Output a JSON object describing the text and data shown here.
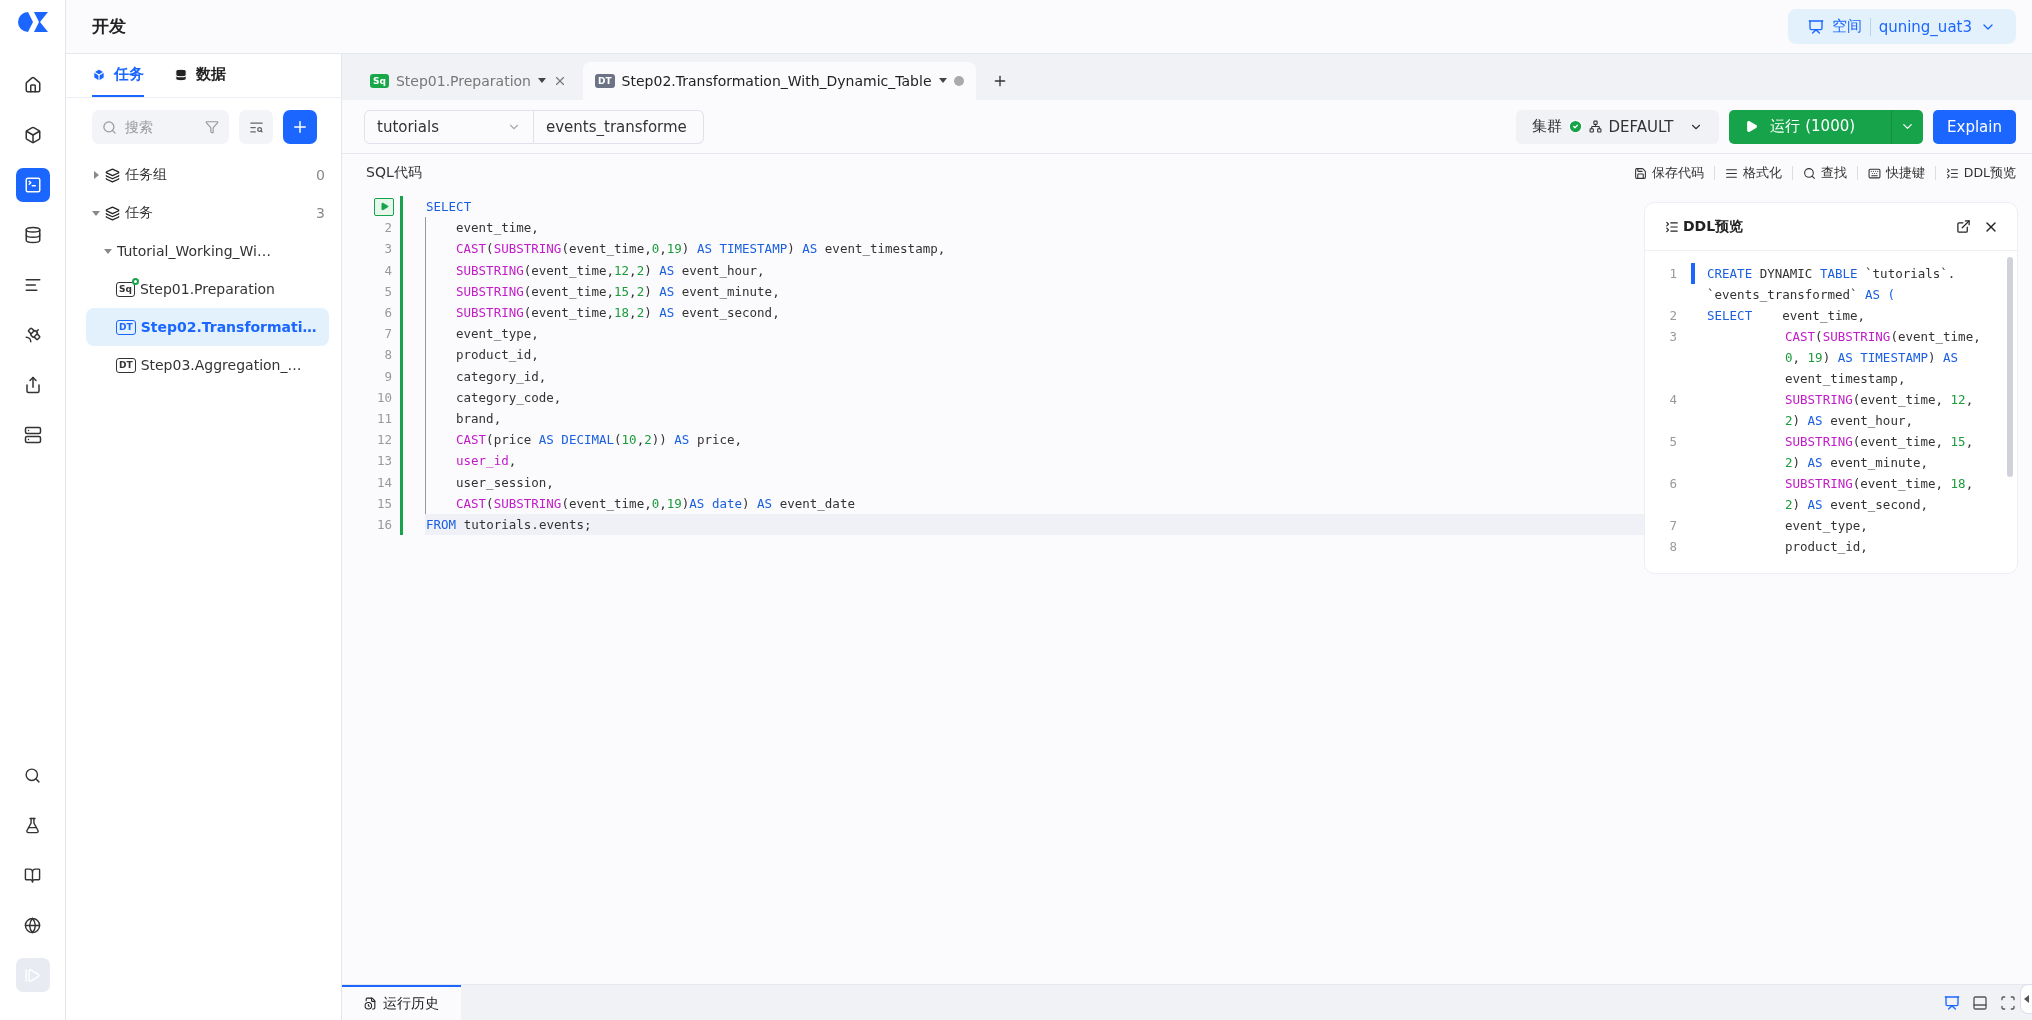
{
  "header": {
    "title": "开发",
    "space": {
      "label": "空间",
      "value": "quning_uat3"
    }
  },
  "rail": {
    "top": [
      {
        "kind": "home",
        "selected": false
      },
      {
        "kind": "cube",
        "selected": false
      },
      {
        "kind": "terminal",
        "selected": true
      },
      {
        "kind": "database",
        "selected": false
      },
      {
        "kind": "list",
        "selected": false
      },
      {
        "kind": "satellite",
        "selected": false
      },
      {
        "kind": "export",
        "selected": false
      },
      {
        "kind": "server",
        "selected": false
      }
    ],
    "bottom": [
      {
        "kind": "search"
      },
      {
        "kind": "flask"
      },
      {
        "kind": "book"
      },
      {
        "kind": "globe"
      },
      {
        "kind": "collapse"
      }
    ]
  },
  "panel": {
    "tabs": [
      {
        "label": "任务",
        "kind": "tasks",
        "selected": true
      },
      {
        "label": "数据",
        "kind": "data",
        "selected": false
      }
    ],
    "search": {
      "placeholder": "搜索"
    },
    "tree": [
      {
        "label": "任务组",
        "count": "0",
        "expanded": false
      },
      {
        "label": "任务",
        "count": "3",
        "expanded": true,
        "children": [
          {
            "label": "Tutorial_Working_Wi…",
            "expanded": true,
            "children": [
              {
                "label": "Step01.Preparation",
                "badge": "Sq",
                "status_dot": true,
                "selected": false
              },
              {
                "label": "Step02.Transformati…",
                "badge": "DT",
                "status_dot": false,
                "selected": true
              },
              {
                "label": "Step03.Aggregation_…",
                "badge": "DT",
                "status_dot": false,
                "selected": false
              }
            ]
          }
        ]
      }
    ]
  },
  "tabs": [
    {
      "label": "Step01.Preparation",
      "badge": "Sq",
      "kind": "sql",
      "selected": false,
      "unsaved": false
    },
    {
      "label": "Step02.Transformation_With_Dynamic_Table",
      "badge": "DT",
      "kind": "dt",
      "selected": true,
      "unsaved": true
    }
  ],
  "toolbar": {
    "schema": "tutorials",
    "table_name": "events_transforme",
    "cluster": {
      "label": "集群",
      "connected": true,
      "value": "DEFAULT"
    },
    "run": "运行 (1000)",
    "explain": "Explain"
  },
  "editor": {
    "title": "SQL代码",
    "actions": [
      {
        "kind": "save",
        "label": "保存代码"
      },
      {
        "kind": "format",
        "label": "格式化"
      },
      {
        "kind": "find",
        "label": "查找"
      },
      {
        "kind": "keys",
        "label": "快捷键"
      },
      {
        "kind": "ddl",
        "label": "DDL预览"
      }
    ],
    "lines": [
      {
        "indent": false,
        "tokens": [
          {
            "kind": "kw",
            "text": "SELECT"
          }
        ]
      },
      {
        "n": "2",
        "indent": true,
        "tokens": [
          {
            "kind": "p",
            "text": "event_time,"
          }
        ]
      },
      {
        "n": "3",
        "indent": true,
        "tokens": [
          {
            "kind": "fn",
            "text": "CAST"
          },
          {
            "kind": "p",
            "text": "("
          },
          {
            "kind": "fn",
            "text": "SUBSTRING"
          },
          {
            "kind": "p",
            "text": "(event_time,"
          },
          {
            "kind": "num",
            "text": "0"
          },
          {
            "kind": "p",
            "text": ","
          },
          {
            "kind": "num",
            "text": "19"
          },
          {
            "kind": "p",
            "text": ") "
          },
          {
            "kind": "kw",
            "text": "AS TIMESTAMP"
          },
          {
            "kind": "p",
            "text": ") "
          },
          {
            "kind": "kw",
            "text": "AS"
          },
          {
            "kind": "p",
            "text": " event_timestamp,"
          }
        ]
      },
      {
        "n": "4",
        "indent": true,
        "tokens": [
          {
            "kind": "fn",
            "text": "SUBSTRING"
          },
          {
            "kind": "p",
            "text": "(event_time,"
          },
          {
            "kind": "num",
            "text": "12"
          },
          {
            "kind": "p",
            "text": ","
          },
          {
            "kind": "num",
            "text": "2"
          },
          {
            "kind": "p",
            "text": ") "
          },
          {
            "kind": "kw",
            "text": "AS"
          },
          {
            "kind": "p",
            "text": " event_hour,"
          }
        ]
      },
      {
        "n": "5",
        "indent": true,
        "tokens": [
          {
            "kind": "fn",
            "text": "SUBSTRING"
          },
          {
            "kind": "p",
            "text": "(event_time,"
          },
          {
            "kind": "num",
            "text": "15"
          },
          {
            "kind": "p",
            "text": ","
          },
          {
            "kind": "num",
            "text": "2"
          },
          {
            "kind": "p",
            "text": ") "
          },
          {
            "kind": "kw",
            "text": "AS"
          },
          {
            "kind": "p",
            "text": " event_minute,"
          }
        ]
      },
      {
        "n": "6",
        "indent": true,
        "tokens": [
          {
            "kind": "fn",
            "text": "SUBSTRING"
          },
          {
            "kind": "p",
            "text": "(event_time,"
          },
          {
            "kind": "num",
            "text": "18"
          },
          {
            "kind": "p",
            "text": ","
          },
          {
            "kind": "num",
            "text": "2"
          },
          {
            "kind": "p",
            "text": ") "
          },
          {
            "kind": "kw",
            "text": "AS"
          },
          {
            "kind": "p",
            "text": " event_second,"
          }
        ]
      },
      {
        "n": "7",
        "indent": true,
        "tokens": [
          {
            "kind": "p",
            "text": "event_type,"
          }
        ]
      },
      {
        "n": "8",
        "indent": true,
        "tokens": [
          {
            "kind": "p",
            "text": "product_id,"
          }
        ]
      },
      {
        "n": "9",
        "indent": true,
        "tokens": [
          {
            "kind": "p",
            "text": "category_id,"
          }
        ]
      },
      {
        "n": "10",
        "indent": true,
        "tokens": [
          {
            "kind": "p",
            "text": "category_code,"
          }
        ]
      },
      {
        "n": "11",
        "indent": true,
        "tokens": [
          {
            "kind": "p",
            "text": "brand,"
          }
        ]
      },
      {
        "n": "12",
        "indent": true,
        "tokens": [
          {
            "kind": "fn",
            "text": "CAST"
          },
          {
            "kind": "p",
            "text": "(price "
          },
          {
            "kind": "kw",
            "text": "AS DECIMAL"
          },
          {
            "kind": "p",
            "text": "("
          },
          {
            "kind": "num",
            "text": "10"
          },
          {
            "kind": "p",
            "text": ","
          },
          {
            "kind": "num",
            "text": "2"
          },
          {
            "kind": "p",
            "text": ")) "
          },
          {
            "kind": "kw",
            "text": "AS"
          },
          {
            "kind": "p",
            "text": " price,"
          }
        ]
      },
      {
        "n": "13",
        "indent": true,
        "tokens": [
          {
            "kind": "fn",
            "text": "user_id"
          },
          {
            "kind": "p",
            "text": ","
          }
        ]
      },
      {
        "n": "14",
        "indent": true,
        "tokens": [
          {
            "kind": "p",
            "text": "user_session,"
          }
        ]
      },
      {
        "n": "15",
        "indent": true,
        "tokens": [
          {
            "kind": "fn",
            "text": "CAST"
          },
          {
            "kind": "p",
            "text": "("
          },
          {
            "kind": "fn",
            "text": "SUBSTRING"
          },
          {
            "kind": "p",
            "text": "(event_time,"
          },
          {
            "kind": "num",
            "text": "0"
          },
          {
            "kind": "p",
            "text": ","
          },
          {
            "kind": "num",
            "text": "19"
          },
          {
            "kind": "p",
            "text": ")"
          },
          {
            "kind": "kw",
            "text": "AS date"
          },
          {
            "kind": "p",
            "text": ") "
          },
          {
            "kind": "kw",
            "text": "AS"
          },
          {
            "kind": "p",
            "text": " event_date"
          }
        ]
      },
      {
        "n": "16",
        "indent": false,
        "tokens": [
          {
            "kind": "kw",
            "text": "FROM"
          },
          {
            "kind": "p",
            "text": " tutorials.events;"
          }
        ]
      }
    ]
  },
  "ddl": {
    "title": "DDL预览",
    "lines": [
      {
        "n": "1",
        "indent": false,
        "rows": [
          {
            "tokens": [
              {
                "kind": "kw",
                "text": "CREATE"
              },
              {
                "kind": "p",
                "text": " DYNAMIC "
              },
              {
                "kind": "kw",
                "text": "TABLE"
              },
              {
                "kind": "p",
                "text": " `tutorials`."
              }
            ]
          },
          {
            "tokens": [
              {
                "kind": "p",
                "text": "`events_transformed` "
              },
              {
                "kind": "kw",
                "text": "AS ("
              }
            ]
          }
        ]
      },
      {
        "n": "2",
        "indent": false,
        "rows": [
          {
            "tokens": [
              {
                "kind": "kw",
                "text": "SELECT"
              },
              {
                "kind": "p",
                "text": "    event_time,"
              }
            ]
          }
        ]
      },
      {
        "n": "3",
        "indent": true,
        "rows": [
          {
            "tokens": [
              {
                "kind": "fn",
                "text": "CAST"
              },
              {
                "kind": "p",
                "text": "("
              },
              {
                "kind": "fn",
                "text": "SUBSTRING"
              },
              {
                "kind": "p",
                "text": "(event_time,"
              }
            ]
          },
          {
            "tokens": [
              {
                "kind": "num",
                "text": "0"
              },
              {
                "kind": "p",
                "text": ", "
              },
              {
                "kind": "num",
                "text": "19"
              },
              {
                "kind": "p",
                "text": ") "
              },
              {
                "kind": "kw",
                "text": "AS TIMESTAMP"
              },
              {
                "kind": "p",
                "text": ") "
              },
              {
                "kind": "kw",
                "text": "AS"
              }
            ]
          },
          {
            "tokens": [
              {
                "kind": "p",
                "text": "event_timestamp,"
              }
            ]
          }
        ]
      },
      {
        "n": "4",
        "indent": true,
        "rows": [
          {
            "tokens": [
              {
                "kind": "fn",
                "text": "SUBSTRING"
              },
              {
                "kind": "p",
                "text": "(event_time, "
              },
              {
                "kind": "num",
                "text": "12"
              },
              {
                "kind": "p",
                "text": ","
              }
            ]
          },
          {
            "tokens": [
              {
                "kind": "num",
                "text": "2"
              },
              {
                "kind": "p",
                "text": ") "
              },
              {
                "kind": "kw",
                "text": "AS"
              },
              {
                "kind": "p",
                "text": " event_hour,"
              }
            ]
          }
        ]
      },
      {
        "n": "5",
        "indent": true,
        "rows": [
          {
            "tokens": [
              {
                "kind": "fn",
                "text": "SUBSTRING"
              },
              {
                "kind": "p",
                "text": "(event_time, "
              },
              {
                "kind": "num",
                "text": "15"
              },
              {
                "kind": "p",
                "text": ","
              }
            ]
          },
          {
            "tokens": [
              {
                "kind": "num",
                "text": "2"
              },
              {
                "kind": "p",
                "text": ") "
              },
              {
                "kind": "kw",
                "text": "AS"
              },
              {
                "kind": "p",
                "text": " event_minute,"
              }
            ]
          }
        ]
      },
      {
        "n": "6",
        "indent": true,
        "rows": [
          {
            "tokens": [
              {
                "kind": "fn",
                "text": "SUBSTRING"
              },
              {
                "kind": "p",
                "text": "(event_time, "
              },
              {
                "kind": "num",
                "text": "18"
              },
              {
                "kind": "p",
                "text": ","
              }
            ]
          },
          {
            "tokens": [
              {
                "kind": "num",
                "text": "2"
              },
              {
                "kind": "p",
                "text": ") "
              },
              {
                "kind": "kw",
                "text": "AS"
              },
              {
                "kind": "p",
                "text": " event_second,"
              }
            ]
          }
        ]
      },
      {
        "n": "7",
        "indent": true,
        "rows": [
          {
            "tokens": [
              {
                "kind": "p",
                "text": "event_type,"
              }
            ]
          }
        ]
      },
      {
        "n": "8",
        "indent": true,
        "rows": [
          {
            "tokens": [
              {
                "kind": "p",
                "text": "product_id,"
              }
            ]
          }
        ]
      }
    ]
  },
  "bottom": {
    "tabs": [
      {
        "label": "运行历史",
        "selected": true
      }
    ],
    "layouts": [
      {
        "kind": "side",
        "selected": true
      },
      {
        "kind": "bottom",
        "selected": false
      },
      {
        "kind": "full",
        "selected": false
      }
    ]
  }
}
